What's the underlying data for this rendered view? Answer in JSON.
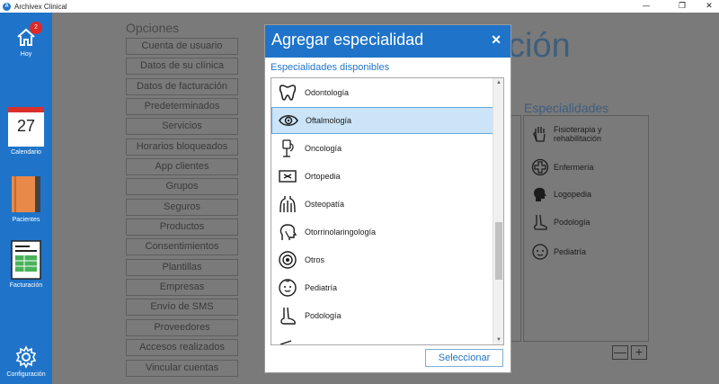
{
  "window": {
    "title": "Archivex Clinical",
    "controls": {
      "minimize": "—",
      "maximize": "❐",
      "close": "✕"
    }
  },
  "sidebar": {
    "home": {
      "label": "Hoy",
      "badge": "2"
    },
    "calendar": {
      "label": "Calendario",
      "day": "27"
    },
    "patients": {
      "label": "Pacientes"
    },
    "billing": {
      "label": "Facturación"
    },
    "settings": {
      "label": "Configuración"
    }
  },
  "background": {
    "options_title": "Opciones",
    "options": [
      "Cuenta de usuario",
      "Datos de su clínica",
      "Datos de facturación",
      "Predeterminados",
      "Servicios",
      "Horarios bloqueados",
      "App clientes",
      "Grupos",
      "Seguros",
      "Productos",
      "Consentimientos",
      "Plantillas",
      "Empresas",
      "Envío de SMS",
      "Proveedores",
      "Accesos realizados",
      "Vincular cuentas"
    ],
    "big_title_fragment": "ción",
    "specialties_title": "Especialidades",
    "specialties": [
      {
        "label_line1": "Fisioterapia y",
        "label_line2": "rehabilitación",
        "icon": "hand-icon"
      },
      {
        "label_line1": "Enfermería",
        "label_line2": "",
        "icon": "medical-cross-icon"
      },
      {
        "label_line1": "Logopedia",
        "label_line2": "",
        "icon": "head-speech-icon"
      },
      {
        "label_line1": "Podología",
        "label_line2": "",
        "icon": "foot-icon"
      },
      {
        "label_line1": "Pediatría",
        "label_line2": "",
        "icon": "baby-icon"
      }
    ],
    "minus_label": "—",
    "plus_label": "+"
  },
  "modal": {
    "title": "Agregar especialidad",
    "close": "✕",
    "section_label": "Especialidades disponibles",
    "items": [
      {
        "label": "Odontología",
        "icon": "tooth-icon",
        "selected": false
      },
      {
        "label": "Oftalmología",
        "icon": "eye-icon",
        "selected": true
      },
      {
        "label": "Oncología",
        "icon": "iv-drip-icon",
        "selected": false
      },
      {
        "label": "Ortopedia",
        "icon": "xray-icon",
        "selected": false
      },
      {
        "label": "Osteopatía",
        "icon": "torso-icon",
        "selected": false
      },
      {
        "label": "Otorrinolaringología",
        "icon": "ent-head-icon",
        "selected": false
      },
      {
        "label": "Otros",
        "icon": "gear-circle-icon",
        "selected": false
      },
      {
        "label": "Pediatría",
        "icon": "baby-icon",
        "selected": false
      },
      {
        "label": "Podología",
        "icon": "foot-icon",
        "selected": false
      }
    ],
    "select_button": "Seleccionar"
  },
  "colors": {
    "accent": "#1f74c9",
    "selection": "#cce4f7",
    "overlay": "#7a7a7a"
  }
}
